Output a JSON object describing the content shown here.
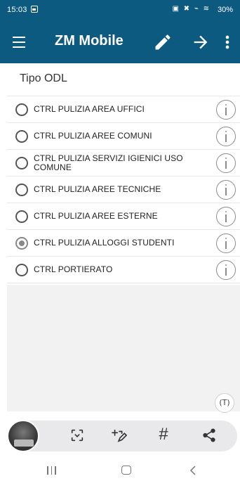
{
  "status_bar": {
    "time": "15:03",
    "system_icons": "▣ ✖ ⌁ ≋",
    "battery": "30%"
  },
  "app_bar": {
    "title": "ZM Mobile",
    "icons": [
      "menu-icon",
      "pencil-icon",
      "arrow-right-icon",
      "more-vert-icon"
    ],
    "color": "#0d5a80"
  },
  "section_title": "Tipo ODL",
  "items": [
    {
      "label": "CTRL PULIZIA AREA UFFICI",
      "selected": false
    },
    {
      "label": "CTRL PULIZIA AREE COMUNI",
      "selected": false
    },
    {
      "label": "CTRL PULIZIA SERVIZI IGIENICI USO COMUNE",
      "selected": false
    },
    {
      "label": "CTRL PULIZIA AREE TECNICHE",
      "selected": false
    },
    {
      "label": "CTRL PULIZIA AREE ESTERNE",
      "selected": false
    },
    {
      "label": "CTRL PULIZIA ALLOGGI STUDENTI",
      "selected": true
    },
    {
      "label": "CTRL PORTIERATO",
      "selected": false
    }
  ],
  "text_extract_label": "(T)",
  "screenshot_toolbar": {
    "icons": [
      "screenshot-thumbnail",
      "scan-icon",
      "add-tag-icon",
      "hashtag-icon",
      "share-icon"
    ],
    "hashtag": "#"
  },
  "nav_bar": {
    "icons": [
      "recents-icon",
      "home-icon",
      "back-icon"
    ]
  }
}
